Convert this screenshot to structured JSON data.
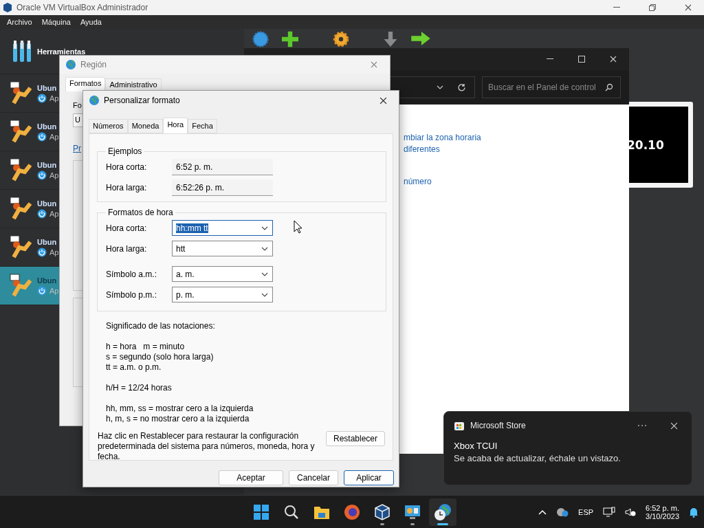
{
  "vbox": {
    "title": "Oracle VM VirtualBox Administrador",
    "menu": [
      {
        "label": "Archivo"
      },
      {
        "label": "Máquina"
      },
      {
        "label": "Ayuda"
      }
    ],
    "tools_label": "Herramientas",
    "machines": [
      {
        "name": "Ubun",
        "state": "Ap",
        "selected": false
      },
      {
        "name": "Ubun",
        "state": "Ap",
        "selected": false
      },
      {
        "name": "Ubun",
        "state": "Ap",
        "selected": false
      },
      {
        "name": "Ubun",
        "state": "Ap",
        "selected": false
      },
      {
        "name": "Ubun",
        "state": "Ap",
        "selected": false
      },
      {
        "name": "Ubun",
        "state": "Ap",
        "selected": true
      }
    ],
    "preview_text": "20.10"
  },
  "control_panel": {
    "search_placeholder": "Buscar en el Panel de control",
    "links": [
      "mbiar la zona horaria",
      "diferentes",
      "número"
    ]
  },
  "region": {
    "title": "Región",
    "tabs": [
      {
        "label": "Formatos",
        "selected": true
      },
      {
        "label": "Administrativo",
        "selected": false
      }
    ],
    "heading_fragment": "Fo",
    "select_fragment": "U",
    "link_fragment": "Pr"
  },
  "customize": {
    "title": "Personalizar formato",
    "tabs": [
      {
        "label": "Números",
        "selected": false
      },
      {
        "label": "Moneda",
        "selected": false
      },
      {
        "label": "Hora",
        "selected": true
      },
      {
        "label": "Fecha",
        "selected": false
      }
    ],
    "examples": {
      "legend": "Ejemplos",
      "rows": [
        {
          "label": "Hora corta:",
          "value": "6:52 p. m."
        },
        {
          "label": "Hora larga:",
          "value": "6:52:26 p. m."
        }
      ]
    },
    "formats": {
      "legend": "Formatos de hora",
      "rows": [
        {
          "label": "Hora corta:",
          "value": "hh:mm tt",
          "focused": true
        },
        {
          "label": "Hora larga:",
          "value": "htt",
          "focused": false
        },
        {
          "label": "Símbolo a.m.:",
          "value": "a. m.",
          "focused": false
        },
        {
          "label": "Símbolo p.m.:",
          "value": "p. m.",
          "focused": false
        }
      ]
    },
    "notes": [
      [
        "Significado de las notaciones:"
      ],
      [
        "h = hora   m = minuto",
        "s = segundo (solo hora larga)",
        "tt = a.m. o p.m."
      ],
      [
        "h/H = 12/24 horas"
      ],
      [
        "hh, mm, ss = mostrar cero a la izquierda",
        "h, m, s = no mostrar cero a la izquierda"
      ]
    ],
    "reset_text": "Haz clic en Restablecer para restaurar la configuración predeterminada del sistema para números, moneda, hora y fecha.",
    "reset_button": "Restablecer",
    "buttons": [
      {
        "label": "Aceptar",
        "default": false
      },
      {
        "label": "Cancelar",
        "default": false
      },
      {
        "label": "Aplicar",
        "default": true
      }
    ]
  },
  "notification": {
    "app": "Microsoft Store",
    "title": "Xbox TCUI",
    "body": "Se acaba de actualizar, échale un vistazo."
  },
  "taskbar": {
    "apps": [
      {
        "kind": "start",
        "running": false,
        "selected": false
      },
      {
        "kind": "search",
        "running": false,
        "selected": false
      },
      {
        "kind": "files",
        "running": false,
        "selected": false
      },
      {
        "kind": "browser",
        "running": false,
        "selected": false
      },
      {
        "kind": "cube",
        "running": true,
        "selected": false
      },
      {
        "kind": "panel",
        "running": true,
        "selected": false
      },
      {
        "kind": "globe",
        "running": true,
        "selected": true
      }
    ],
    "language": "ESP",
    "time": "6:52 p. m.",
    "date": "3/10/2023"
  }
}
